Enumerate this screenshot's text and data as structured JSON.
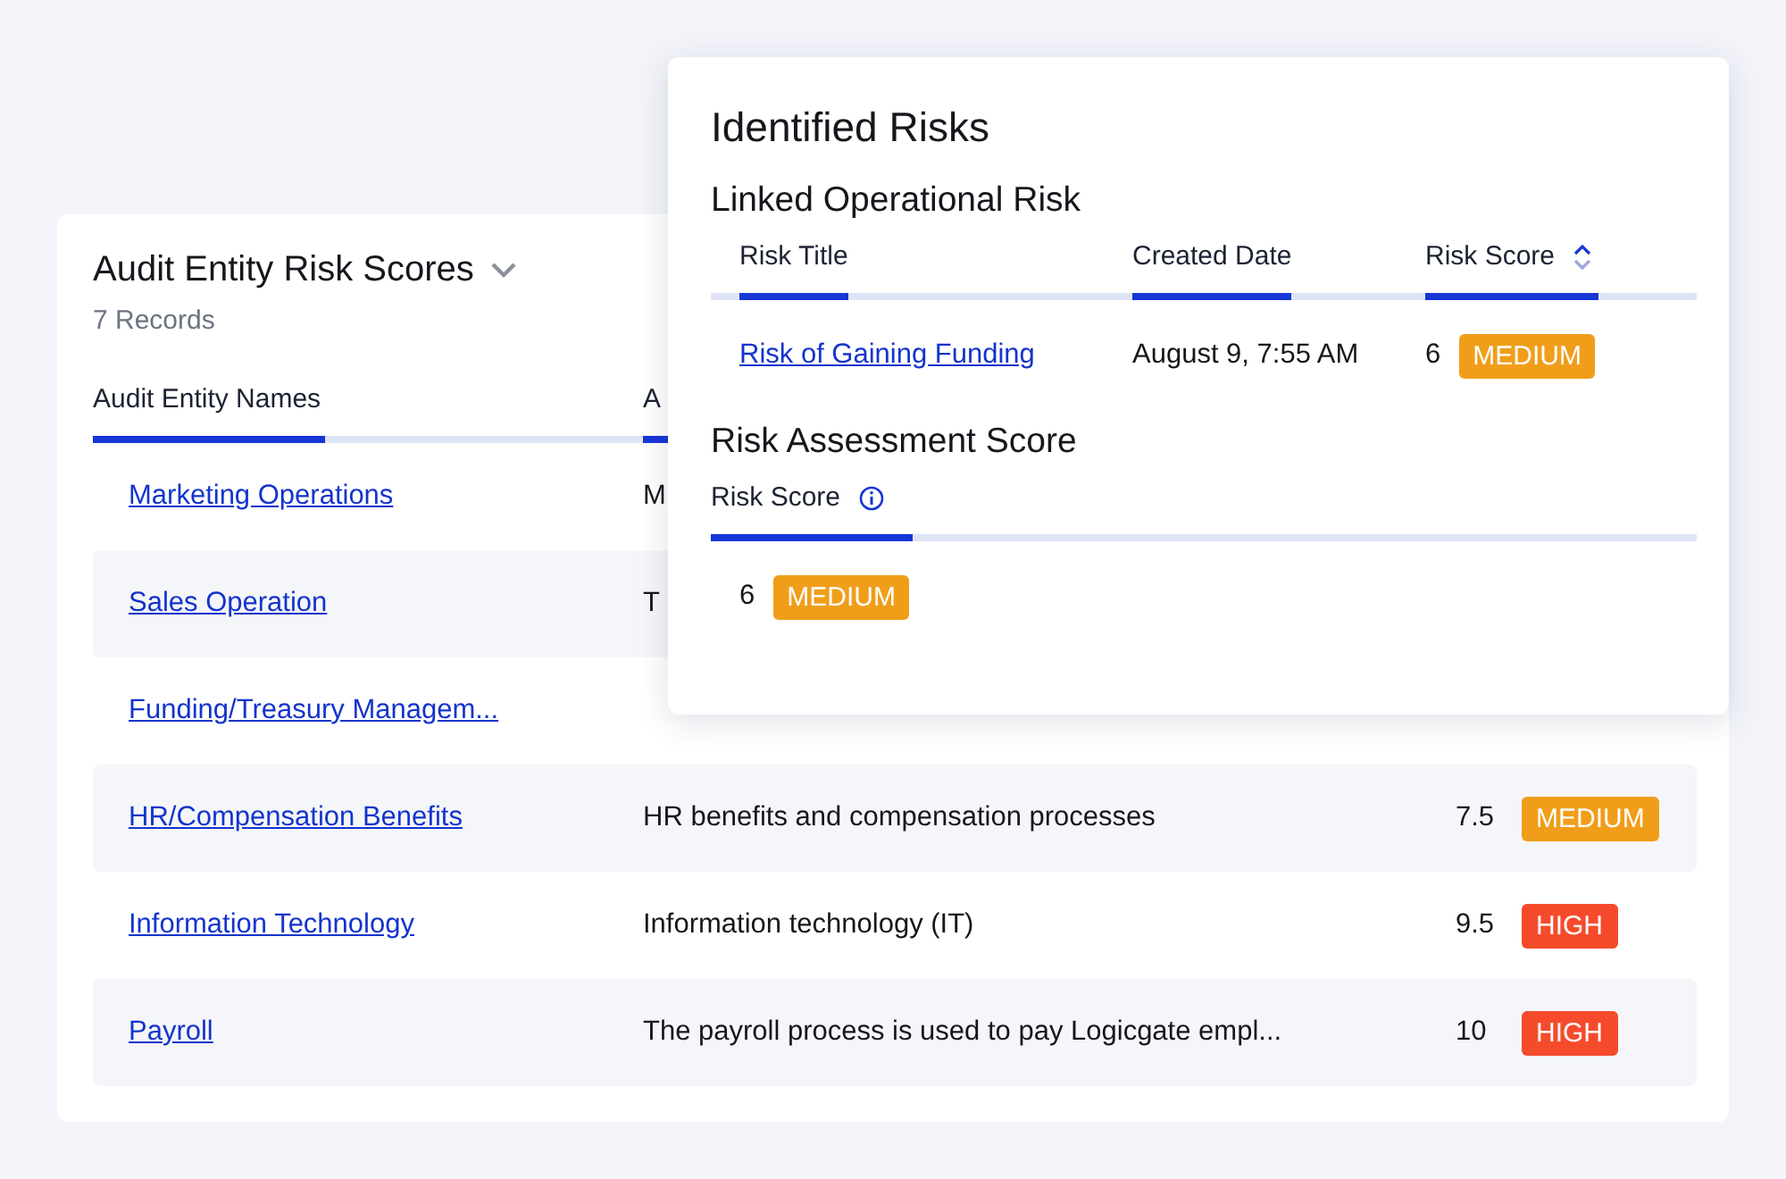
{
  "entity_card": {
    "title": "Audit Entity Risk Scores",
    "record_count": "7 Records",
    "columns": [
      {
        "label": "Audit Entity Names"
      },
      {
        "label": "A"
      }
    ],
    "rows": [
      {
        "name": "Marketing Operations",
        "description": "M"
      },
      {
        "name": "Sales Operation",
        "description": "T"
      },
      {
        "name": "Funding/Treasury Managem..."
      },
      {
        "name": "HR/Compensation Benefits",
        "description": "HR benefits and compensation processes",
        "score": "7.5",
        "badge": {
          "label": "MEDIUM",
          "kind": "medium"
        }
      },
      {
        "name": "Information Technology",
        "description": "Information technology (IT)",
        "score": "9.5",
        "badge": {
          "label": "HIGH",
          "kind": "high"
        }
      },
      {
        "name": "Payroll",
        "description": "The payroll process is used to pay Logicgate empl...",
        "score": "10",
        "badge": {
          "label": "HIGH",
          "kind": "high"
        }
      }
    ]
  },
  "risks_popup": {
    "title": "Identified Risks",
    "linked": {
      "heading": "Linked Operational Risk",
      "columns": [
        {
          "label": "Risk Title",
          "sortable": false
        },
        {
          "label": "Created Date",
          "sortable": false
        },
        {
          "label": "Risk Score",
          "sortable": true
        }
      ],
      "rows": [
        {
          "title": "Risk of Gaining Funding",
          "created": "August 9, 7:55 AM",
          "score": "6",
          "badge": {
            "label": "MEDIUM",
            "kind": "medium"
          }
        }
      ]
    },
    "assessment": {
      "heading": "Risk Assessment Score",
      "column": {
        "label": "Risk Score",
        "info": true
      },
      "score": "6",
      "badge": {
        "label": "MEDIUM",
        "kind": "medium"
      }
    }
  }
}
